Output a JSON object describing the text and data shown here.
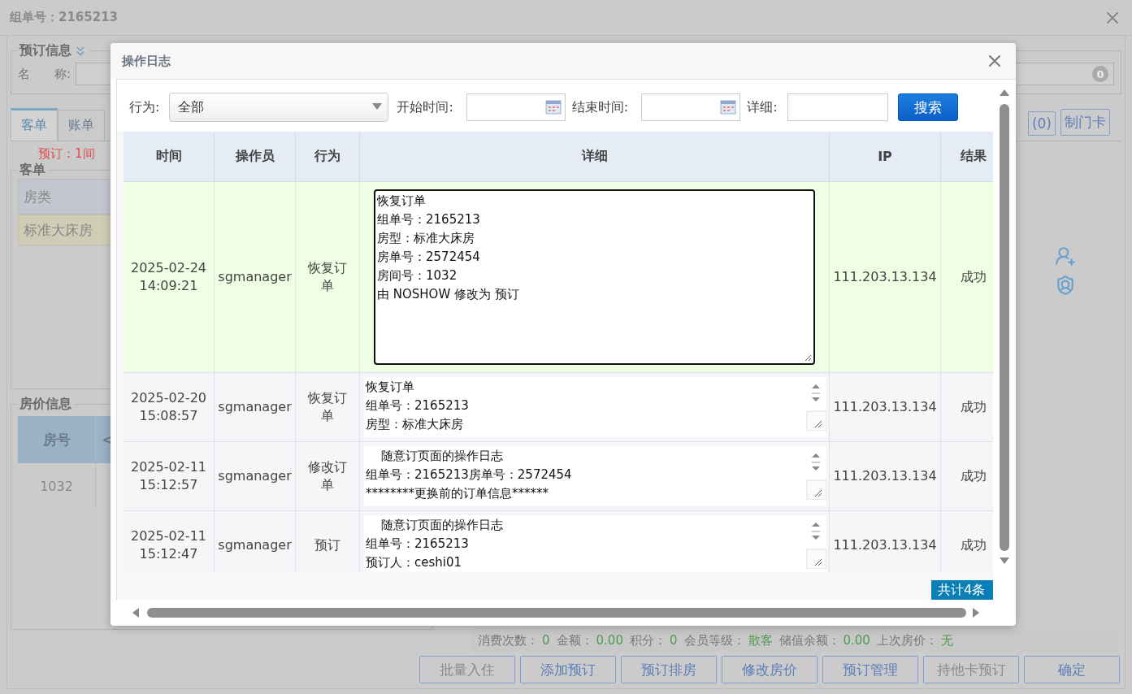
{
  "app": {
    "title": "组单号：2165213"
  },
  "booking_info": {
    "legend": "预订信息",
    "name_label": "名　　称:",
    "badge": "0"
  },
  "tabs": [
    {
      "label": "客单",
      "selected": true
    },
    {
      "label": "账单",
      "selected": false
    }
  ],
  "tab_buttons": [
    "(0)",
    "制门卡"
  ],
  "booking_count": "预订：1间",
  "guest_panel": {
    "legend": "客单",
    "column": "房类",
    "row": "标准大床房"
  },
  "rate_panel": {
    "legend": "房价信息",
    "column": "房号",
    "column_2": "<",
    "row": "1032"
  },
  "stats": [
    {
      "label": "消费次数：",
      "value": "0"
    },
    {
      "label": "金额：",
      "value": "0.00"
    },
    {
      "label": "积分：",
      "value": "0"
    },
    {
      "label": "会员等级：",
      "value": "散客"
    },
    {
      "label": "储值余额：",
      "value": "0.00"
    },
    {
      "label": "上次房价：",
      "value": "无"
    }
  ],
  "footer_buttons": [
    {
      "label": "批量入住",
      "disabled": true
    },
    {
      "label": "添加预订",
      "disabled": false
    },
    {
      "label": "预订排房",
      "disabled": false
    },
    {
      "label": "修改房价",
      "disabled": false
    },
    {
      "label": "预订管理",
      "disabled": false
    },
    {
      "label": "持他卡预订",
      "disabled": true
    },
    {
      "label": "确定",
      "disabled": false
    }
  ],
  "log_dialog": {
    "title": "操作日志",
    "filters": {
      "action_label": "行为:",
      "action_value": "全部",
      "start_label": "开始时间:",
      "end_label": "结束时间:",
      "detail_label": "详细:",
      "search": "搜索"
    },
    "columns": [
      "时间",
      "操作员",
      "行为",
      "详细",
      "IP",
      "结果"
    ],
    "rows": [
      {
        "selected": true,
        "time": "2025-02-24 14:09:21",
        "operator": "sgmanager",
        "action": "恢复订单",
        "detail": [
          "恢复订单",
          "组单号：2165213",
          "房型：标准大床房",
          "房单号：2572454",
          "房间号：1032",
          "由 NOSHOW 修改为 预订"
        ],
        "ip": "111.203.13.134",
        "result": "成功"
      },
      {
        "selected": false,
        "time": "2025-02-20 15:08:57",
        "operator": "sgmanager",
        "action": "恢复订单",
        "detail": [
          "恢复订单",
          "组单号：2165213",
          "房型：标准大床房"
        ],
        "ip": "111.203.13.134",
        "result": "成功"
      },
      {
        "selected": false,
        "time": "2025-02-11 15:12:57",
        "operator": "sgmanager",
        "action": "修改订单",
        "detail": [
          "    随意订页面的操作日志",
          "组单号：2165213房单号：2572454",
          "********更换前的订单信息******"
        ],
        "ip": "111.203.13.134",
        "result": "成功"
      },
      {
        "selected": false,
        "time": "2025-02-11 15:12:47",
        "operator": "sgmanager",
        "action": "预订",
        "detail": [
          "    随意订页面的操作日志",
          "组单号：2165213",
          "预订人：ceshi01"
        ],
        "ip": "111.203.13.134",
        "result": "成功"
      }
    ],
    "total": "共计4条"
  }
}
